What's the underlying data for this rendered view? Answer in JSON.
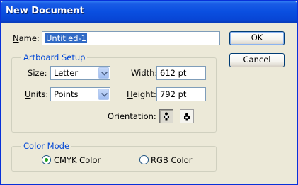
{
  "window": {
    "title": "New Document"
  },
  "name_field": {
    "label": "Name:",
    "value": "Untitled-1"
  },
  "buttons": {
    "ok": "OK",
    "cancel": "Cancel"
  },
  "artboard": {
    "title": "Artboard Setup",
    "size_label": "Size:",
    "size_value": "Letter",
    "width_label": "Width:",
    "width_value": "612 pt",
    "units_label": "Units:",
    "units_value": "Points",
    "height_label": "Height:",
    "height_value": "792 pt",
    "orientation_label": "Orientation:",
    "orientation_selected": "portrait"
  },
  "color_mode": {
    "title": "Color Mode",
    "options": [
      {
        "label": "CMYK Color",
        "checked": true
      },
      {
        "label": "RGB Color",
        "checked": false
      }
    ]
  },
  "colors": {
    "title_bar": "#0a4fe0",
    "group_title": "#0046d5",
    "selection": "#316ac5"
  }
}
